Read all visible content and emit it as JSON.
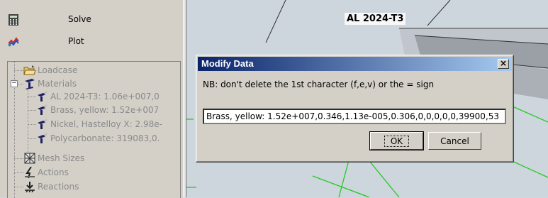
{
  "left_panel": {
    "solve_label": "Solve",
    "plot_label": "Plot"
  },
  "tree": {
    "items": [
      {
        "label": "Loadcase",
        "icon": "folder-open-icon"
      },
      {
        "label": "Materials",
        "icon": "material-beam-icon"
      },
      {
        "label": "AL 2024-T3: 1.06e+007,0",
        "icon": "material-item-icon"
      },
      {
        "label": "Brass, yellow: 1.52e+007",
        "icon": "material-item-icon"
      },
      {
        "label": "Nickel, Hastelloy X: 2.98e-",
        "icon": "material-item-icon"
      },
      {
        "label": "Polycarbonate: 319083,0.",
        "icon": "material-item-icon"
      },
      {
        "label": "Mesh Sizes",
        "icon": "mesh-icon"
      },
      {
        "label": "Actions",
        "icon": "actions-icon"
      },
      {
        "label": "Reactions",
        "icon": "reactions-icon"
      }
    ],
    "expander_symbol": "−"
  },
  "view": {
    "material_label": "AL 2024-T3"
  },
  "dialog": {
    "title": "Modify Data",
    "close_symbol": "×",
    "note": "NB: don't delete the 1st character (f,e,v) or the = sign",
    "value": "Brass, yellow: 1.52e+007,0.346,1.13e-005,0.306,0,0,0,0,0,39900,53",
    "ok_label": "OK",
    "cancel_label": "Cancel"
  },
  "colors": {
    "titlebar_start": "#0a246a",
    "titlebar_end": "#a6caf0",
    "panel_bg": "#d4d0c8",
    "view_bg": "#cdd5dd",
    "green_line": "#22cc22"
  }
}
